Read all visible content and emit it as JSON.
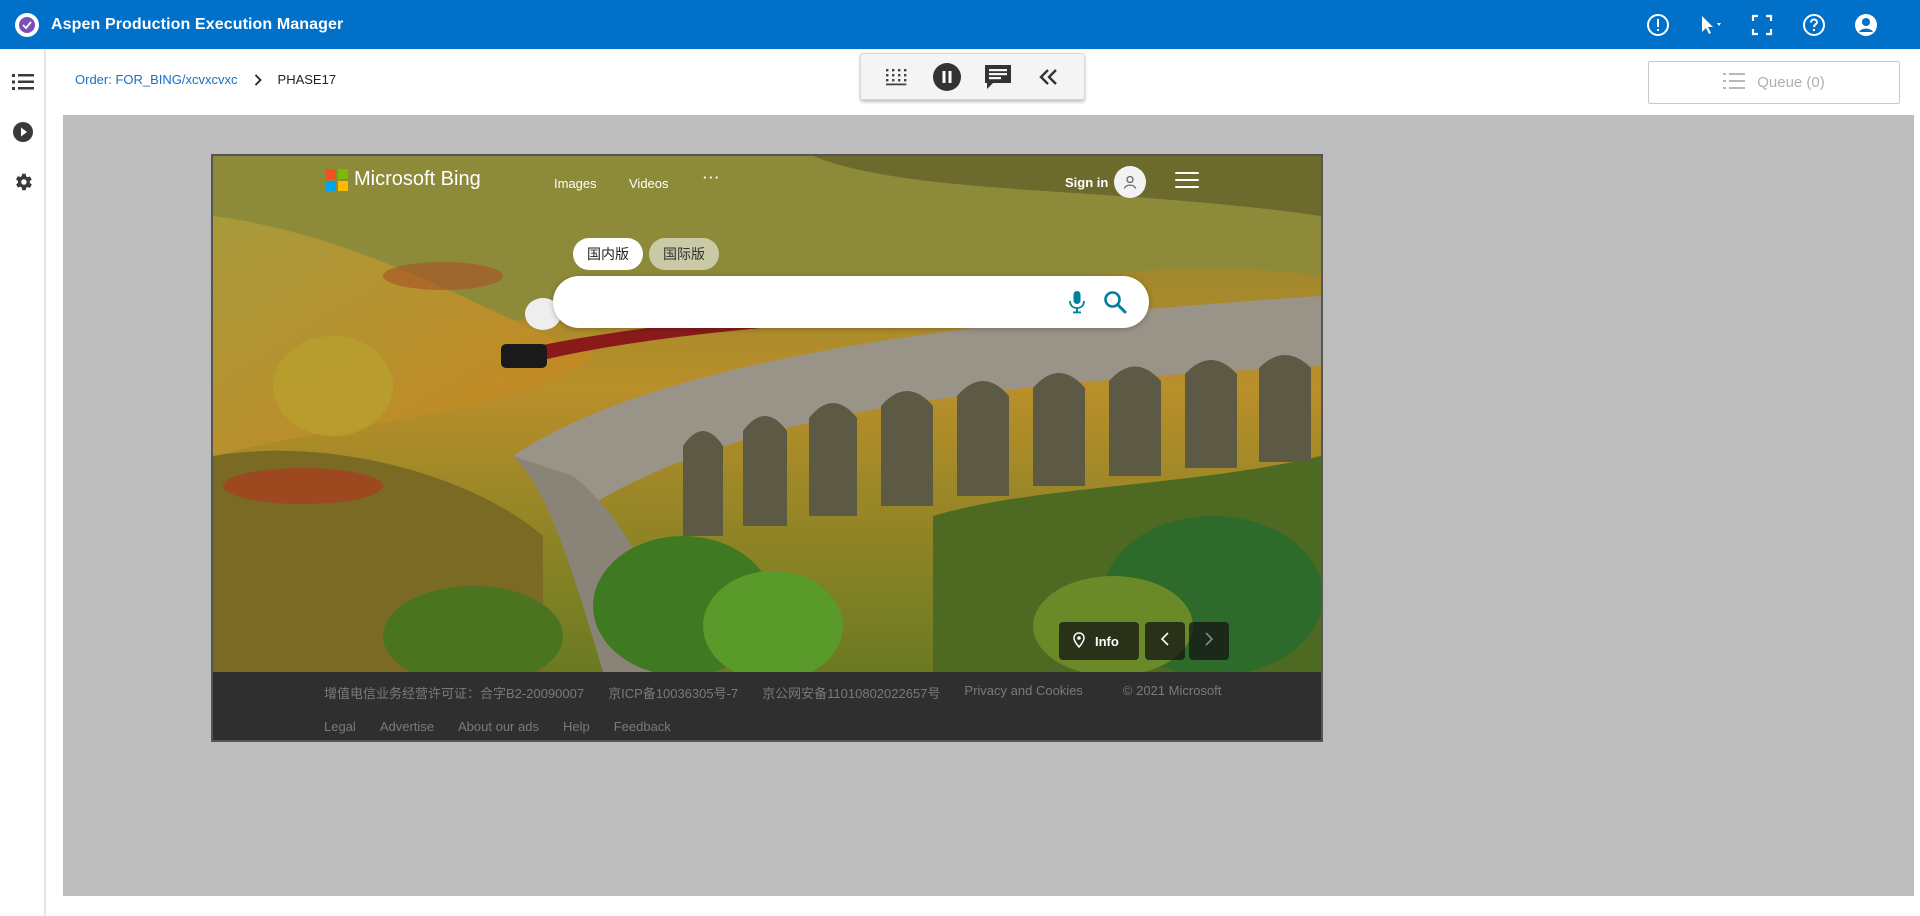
{
  "app": {
    "title": "Aspen Production Execution Manager"
  },
  "breadcrumb": {
    "order_link": "Order: FOR_BING/xcvxcvxc",
    "current": "PHASE17"
  },
  "queue": {
    "label": "Queue (0)"
  },
  "bing": {
    "brand": "Microsoft Bing",
    "nav": [
      "Images",
      "Videos",
      "· · ·"
    ],
    "signin": "Sign in",
    "scope_tabs": [
      "国内版",
      "国际版"
    ],
    "search": {
      "value": "",
      "placeholder": ""
    },
    "info_label": "Info",
    "footer_row1": [
      "增值电信业务经营许可证：合字B2-20090007",
      "京ICP备10036305号-7",
      "京公网安备11010802022657号",
      "Privacy and Cookies",
      "© 2021 Microsoft"
    ],
    "footer_row2": [
      "Legal",
      "Advertise",
      "About our ads",
      "Help",
      "Feedback"
    ]
  },
  "colors": {
    "appbar": "#0070c9",
    "link": "#1a6fc4",
    "workarea": "#bdbdbd",
    "bing_accent": "#00809d"
  }
}
